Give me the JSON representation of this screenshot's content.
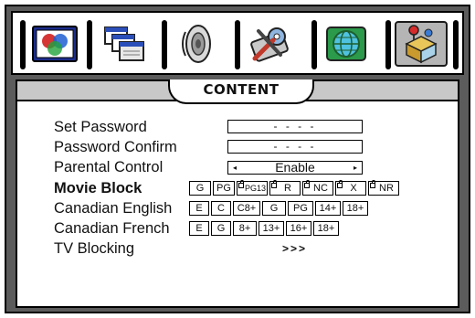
{
  "tabs": [
    {
      "name": "picture-icon",
      "selected": false
    },
    {
      "name": "windows-icon",
      "selected": false
    },
    {
      "name": "speaker-icon",
      "selected": false
    },
    {
      "name": "tools-icon",
      "selected": false
    },
    {
      "name": "globe-icon",
      "selected": false
    },
    {
      "name": "content-lock-icon",
      "selected": true
    }
  ],
  "panel": {
    "title": "CONTENT"
  },
  "rows": {
    "set_password": {
      "label": "Set Password",
      "value": "- - - -"
    },
    "password_confirm": {
      "label": "Password Confirm",
      "value": "- - - -"
    },
    "parental_control": {
      "label": "Parental Control",
      "value": "Enable",
      "left_arrow": "◂",
      "right_arrow": "▸"
    },
    "movie_block": {
      "label": "Movie Block",
      "ratings": [
        "G",
        "PG",
        "PG13",
        "R",
        "NC",
        "X",
        "NR"
      ]
    },
    "canadian_english": {
      "label": "Canadian English",
      "ratings": [
        "E",
        "C",
        "C8+",
        "G",
        "PG",
        "14+",
        "18+"
      ]
    },
    "canadian_french": {
      "label": "Canadian French",
      "ratings": [
        "E",
        "G",
        "8+",
        "13+",
        "16+",
        "18+"
      ]
    },
    "tv_blocking": {
      "label": "TV Blocking",
      "value": ">>>"
    }
  },
  "colors": {
    "frame": "#5c5c5c",
    "header": "#c8c8c8",
    "selected_tab": "#b5b5b5"
  }
}
